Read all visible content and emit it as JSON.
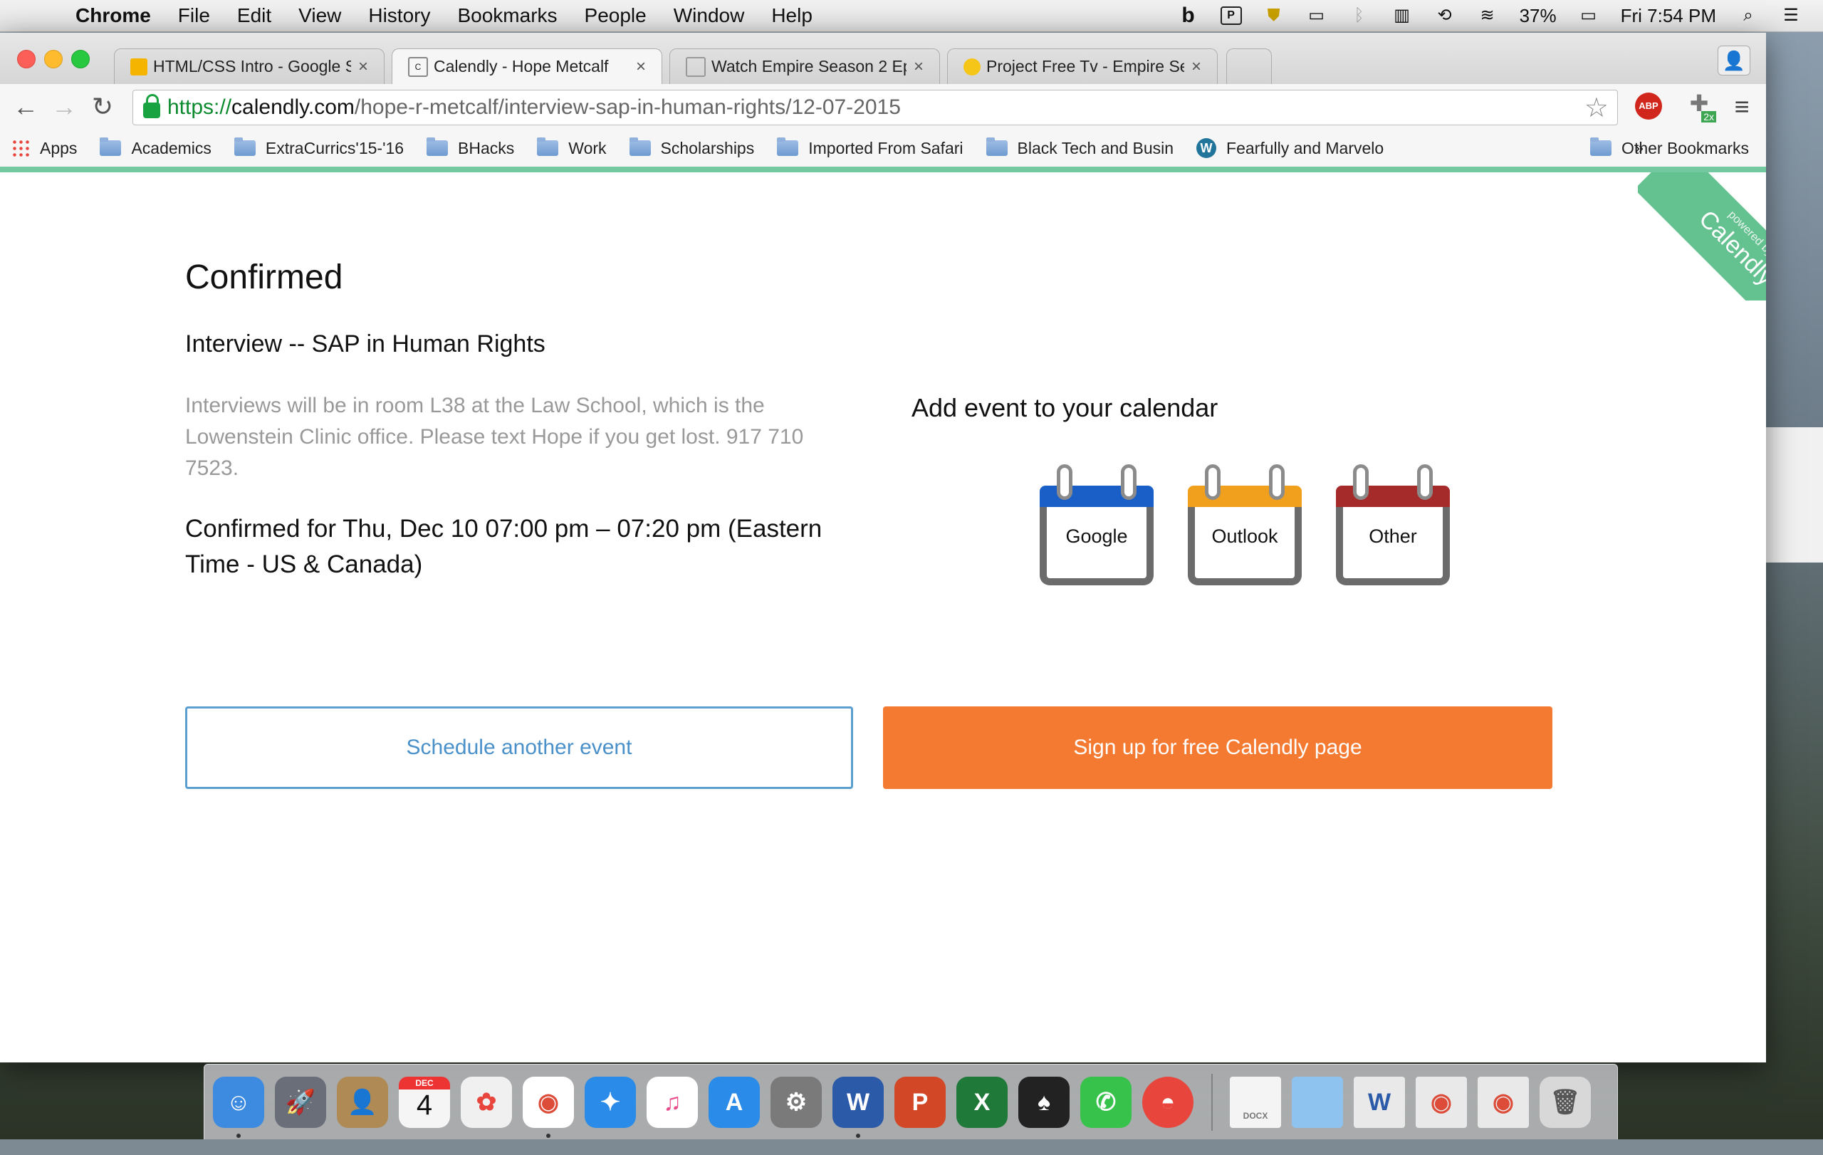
{
  "menubar": {
    "app": "Chrome",
    "items": [
      "File",
      "Edit",
      "View",
      "History",
      "Bookmarks",
      "People",
      "Window",
      "Help"
    ],
    "battery": "37%",
    "clock": "Fri 7:54 PM"
  },
  "tabs": [
    {
      "title": "HTML/CSS Intro - Google S",
      "favicon_color": "#f4b400"
    },
    {
      "title": "Calendly - Hope Metcalf",
      "favicon_color": "#ffffff"
    },
    {
      "title": "Watch Empire Season 2 Ep",
      "favicon_color": "#ffffff"
    },
    {
      "title": "Project Free Tv - Empire Se",
      "favicon_color": "#f5c518"
    }
  ],
  "address": {
    "scheme": "https://",
    "host": "calendly.com",
    "path": "/hope-r-metcalf/interview-sap-in-human-rights/12-07-2015"
  },
  "extensions": {
    "abp": "ABP",
    "badge": "2x"
  },
  "bookmarks": {
    "apps": "Apps",
    "items": [
      "Academics",
      "ExtraCurrics'15-'16",
      "BHacks",
      "Work",
      "Scholarships",
      "Imported From Safari",
      "Black Tech and Busin",
      "Fearfully and Marvelo"
    ],
    "overflow": "»",
    "other": "Other Bookmarks"
  },
  "ribbon": {
    "small": "powered by",
    "big": "Calendly"
  },
  "confirmation": {
    "heading": "Confirmed",
    "event_name": "Interview -- SAP in Human Rights",
    "description": "Interviews will be in room L38 at the Law School, which is the Lowenstein Clinic office. Please text Hope if you get lost. 917 710 7523.",
    "confirmed_for": "Confirmed for Thu, Dec 10 07:00 pm – 07:20 pm (Eastern Time - US & Canada)"
  },
  "calendar": {
    "heading": "Add event to your calendar",
    "options": [
      {
        "label": "Google",
        "color": "#1a5fc8"
      },
      {
        "label": "Outlook",
        "color": "#f0a01c"
      },
      {
        "label": "Other",
        "color": "#a52a2a"
      }
    ]
  },
  "actions": {
    "schedule_another": "Schedule another event",
    "signup": "Sign up for free Calendly page"
  },
  "dock": {
    "calendar_month": "DEC",
    "calendar_day": "4",
    "items": [
      {
        "name": "finder",
        "glyph": "☺",
        "color": "#3d8be0"
      },
      {
        "name": "launchpad",
        "glyph": "🚀",
        "color": "#6a6e78"
      },
      {
        "name": "contacts",
        "glyph": "👤",
        "color": "#b08a55"
      },
      {
        "name": "calendar",
        "glyph": "4",
        "color": "#f5f5f5"
      },
      {
        "name": "photos",
        "glyph": "✿",
        "color": "#f0f0f0"
      },
      {
        "name": "chrome",
        "glyph": "◉",
        "color": "#dd4b39"
      },
      {
        "name": "safari",
        "glyph": "✦",
        "color": "#2a8ce8"
      },
      {
        "name": "itunes",
        "glyph": "♫",
        "color": "#e94c8b"
      },
      {
        "name": "app-store",
        "glyph": "A",
        "color": "#2a8ce8"
      },
      {
        "name": "system-preferences",
        "glyph": "⚙",
        "color": "#7a7a7a"
      },
      {
        "name": "word",
        "glyph": "W",
        "color": "#2b5aa8"
      },
      {
        "name": "powerpoint",
        "glyph": "P",
        "color": "#d24726"
      },
      {
        "name": "excel",
        "glyph": "X",
        "color": "#1f7a3a"
      },
      {
        "name": "game",
        "glyph": "♠",
        "color": "#222222"
      },
      {
        "name": "facetime",
        "glyph": "✆",
        "color": "#37c24b"
      },
      {
        "name": "sunrise",
        "glyph": "◓",
        "color": "#e8453c"
      }
    ],
    "docs": [
      {
        "name": "docx-file",
        "glyph": "DOCX",
        "color": "#f4f4f4"
      },
      {
        "name": "folder",
        "glyph": "",
        "color": "#8ec3ef"
      },
      {
        "name": "word-doc-thumb",
        "glyph": "W",
        "color": "#e9e9e9"
      },
      {
        "name": "chrome-doc-thumb",
        "glyph": "◉",
        "color": "#e9e9e9"
      },
      {
        "name": "chrome-doc-thumb-2",
        "glyph": "◉",
        "color": "#e9e9e9"
      },
      {
        "name": "trash",
        "glyph": "🗑",
        "color": "#d8d8d8"
      }
    ]
  }
}
